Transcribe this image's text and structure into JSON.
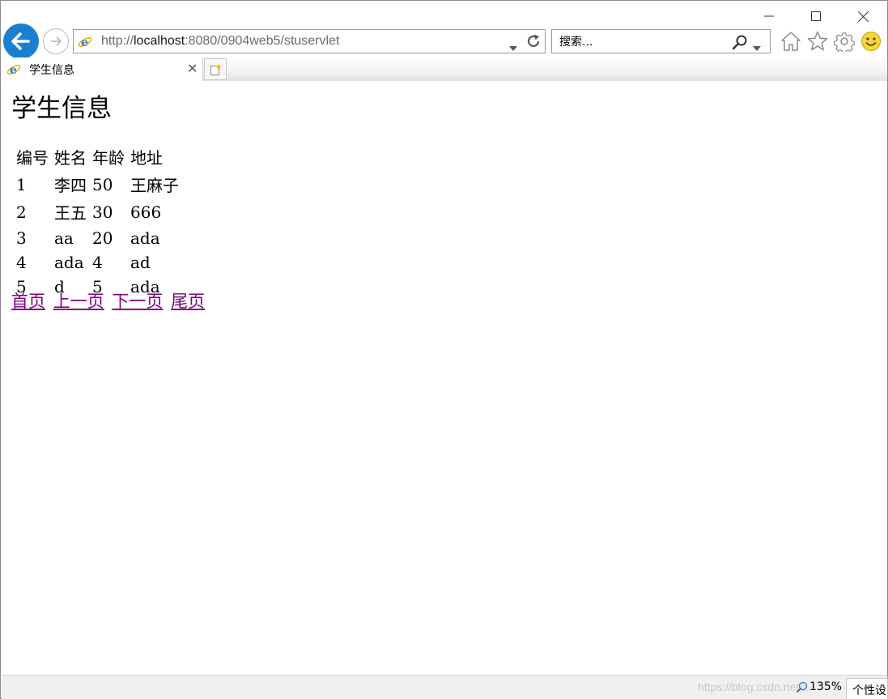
{
  "window": {
    "minimize_icon": "minimize-icon",
    "maximize_icon": "maximize-icon",
    "close_icon": "close-icon"
  },
  "navbar": {
    "url_prefix": "http://",
    "url_host": "localhost",
    "url_rest": ":8080/0904web5/stuservlet",
    "search_placeholder": "搜索...",
    "accent_color": "#1a7fd0"
  },
  "tab": {
    "title": "学生信息",
    "close_label": "✕"
  },
  "page": {
    "heading": "学生信息",
    "table": {
      "headers": [
        "编号",
        "姓名",
        "年龄",
        "地址"
      ],
      "rows": [
        [
          "1",
          "李四",
          "50",
          "王麻子"
        ],
        [
          "2",
          "王五",
          "30",
          "666"
        ],
        [
          "3",
          "aa",
          "20",
          "ada"
        ],
        [
          "4",
          "ada",
          "4",
          "ad"
        ],
        [
          "5",
          "d",
          "5",
          "ada"
        ]
      ]
    },
    "pager": {
      "first": "首页",
      "prev": "上一页",
      "next": "下一页",
      "last": "尾页",
      "link_color": "#800080"
    }
  },
  "statusbar": {
    "watermark": "https://blog.csdn.net/...",
    "zoom": "135%",
    "personalize": "个性设"
  }
}
